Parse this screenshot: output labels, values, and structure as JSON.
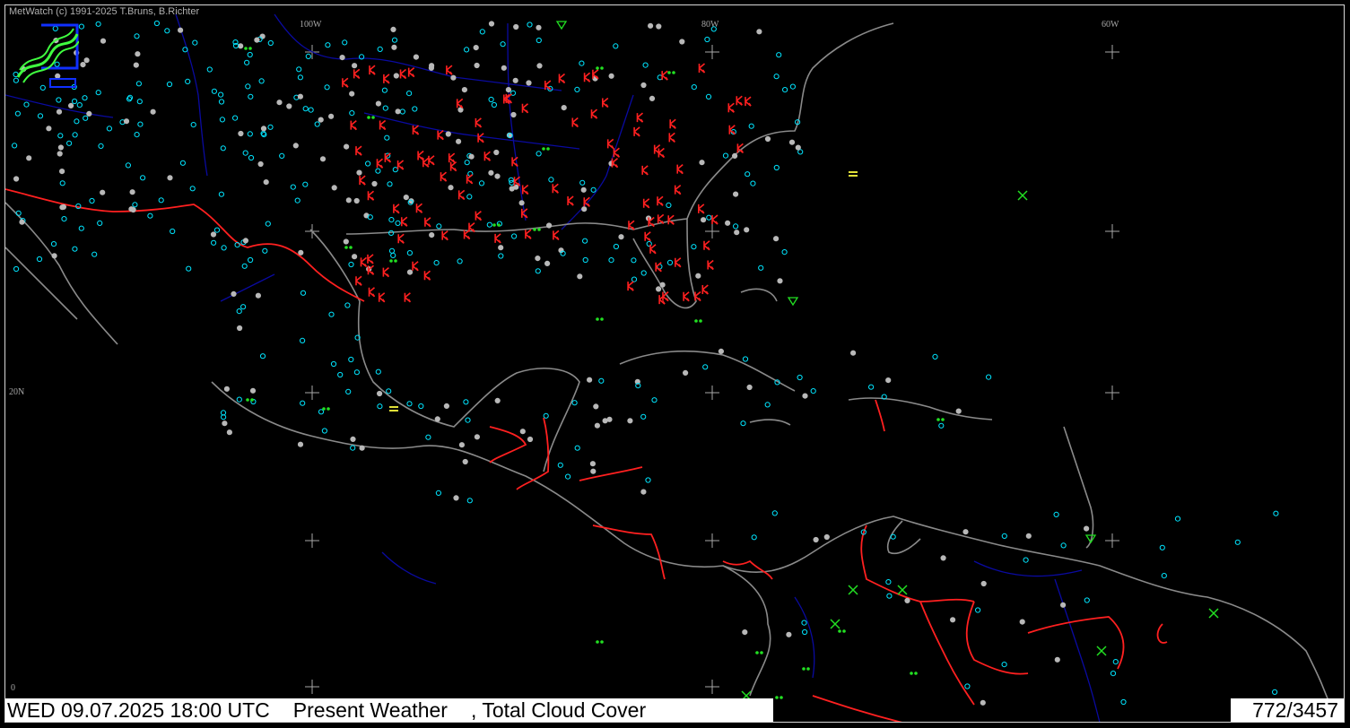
{
  "header": {
    "credit": "MetWatch  (c) 1991-2025 T.Bruns, B.Richter"
  },
  "grid_labels": {
    "lon_100w": "100W",
    "lon_80w": "80W",
    "lon_60w": "60W",
    "lat_20n": "20N",
    "lat_0": "0"
  },
  "status_bar": {
    "datetime": "WED 09.07.2025 18:00 UTC",
    "parameter_1": "Present Weather",
    "parameter_2": ", Total Cloud Cover",
    "station_count": "772/3457"
  },
  "colors": {
    "background": "#000000",
    "coastline": "#8a8a8a",
    "country_border": "#ff2020",
    "rivers_states": "#0a0aa0",
    "cloud_clear": "#00e5ff",
    "cloud_overcast": "#b8b8b8",
    "thunderstorm": "#ff2020",
    "precipitation": "#22e022",
    "haze": "#ffff40",
    "grid_cross": "#a8a8a8"
  },
  "icons": {
    "logo": "metwatch-logo-icon",
    "thunderstorm": "thunderstorm-symbol-icon",
    "rain": "rain-symbol-icon",
    "shower": "shower-symbol-icon",
    "haze": "haze-symbol-icon",
    "station": "cloud-cover-station-icon"
  }
}
